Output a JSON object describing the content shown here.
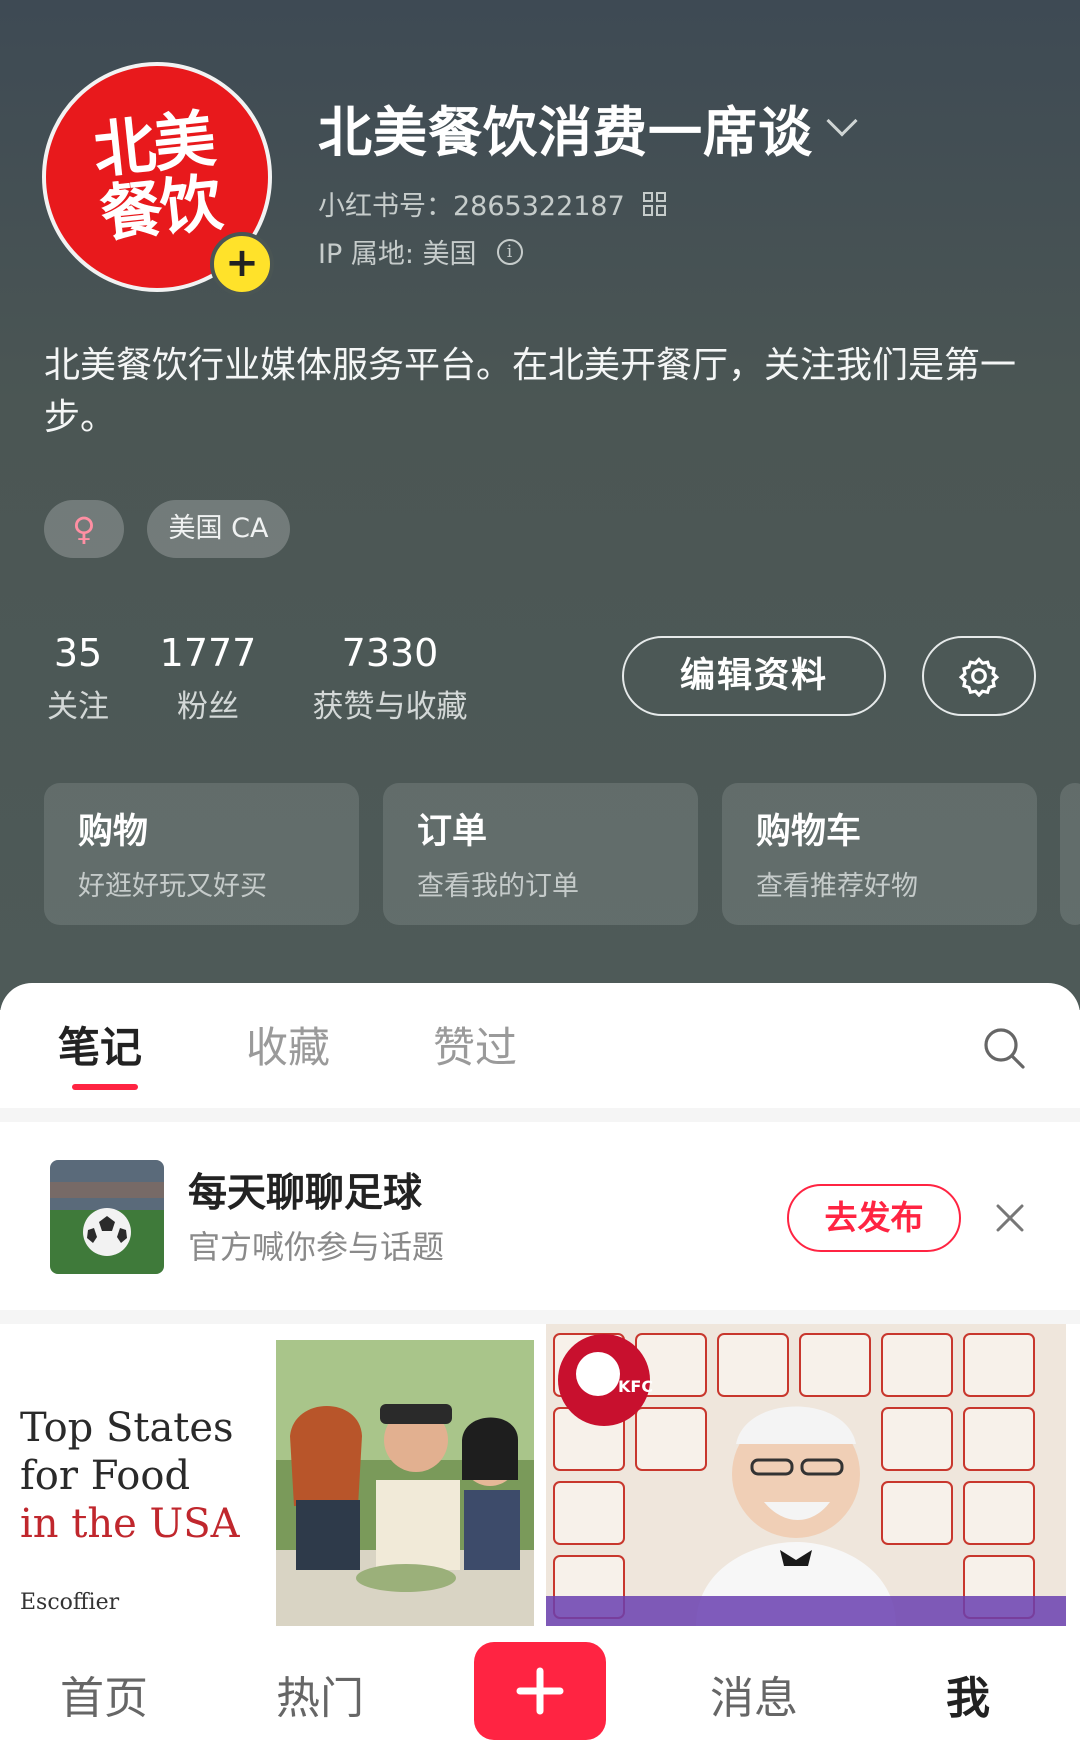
{
  "profile": {
    "avatar_text": "北美餐饮",
    "name": "北美餐饮消费一席谈",
    "id_line": "小红书号：2865322187",
    "ip_line": "IP 属地: 美国",
    "bio": "北美餐饮行业媒体服务平台。在北美开餐厅，关注我们是第一步。",
    "tags": {
      "gender_symbol": "♀",
      "location": "美国 CA"
    }
  },
  "stats": [
    {
      "value": "35",
      "label": "关注"
    },
    {
      "value": "1777",
      "label": "粉丝"
    },
    {
      "value": "7330",
      "label": "获赞与收藏"
    }
  ],
  "buttons": {
    "edit_profile": "编辑资料"
  },
  "cards": [
    {
      "title": "购物",
      "subtitle": "好逛好玩又好买"
    },
    {
      "title": "订单",
      "subtitle": "查看我的订单"
    },
    {
      "title": "购物车",
      "subtitle": "查看推荐好物"
    }
  ],
  "tabs": [
    {
      "label": "笔记",
      "active": true
    },
    {
      "label": "收藏",
      "active": false
    },
    {
      "label": "赞过",
      "active": false
    }
  ],
  "topic": {
    "title": "每天聊聊足球",
    "subtitle": "官方喊你参与话题",
    "publish_label": "去发布"
  },
  "notes": [
    {
      "title_line1": "Top States",
      "title_line2": "for Food",
      "title_line3": "in the USA",
      "brand": "Escoffier"
    },
    {
      "logo_text": "KFC"
    }
  ],
  "bottom_nav": {
    "home": "首页",
    "hot": "热门",
    "messages": "消息",
    "me": "我"
  },
  "colors": {
    "accent": "#ff2442",
    "header_bg": "#4b5654",
    "avatar_red": "#e8191c",
    "add_yellow": "#ffe22a"
  }
}
